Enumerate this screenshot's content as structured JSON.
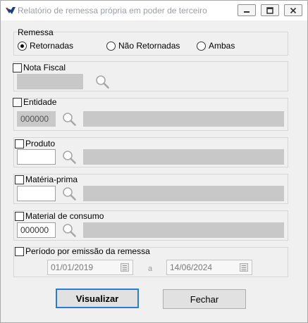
{
  "window": {
    "title": "Relatório de remessa própria em poder de terceiro"
  },
  "remessa": {
    "label": "Remessa",
    "options": [
      "Retornadas",
      "Não Retornadas",
      "Ambas"
    ],
    "selected": "Retornadas"
  },
  "nota_fiscal": {
    "label": "Nota Fiscal",
    "checked": false,
    "value": ""
  },
  "entidade": {
    "label": "Entidade",
    "checked": false,
    "code": "000000",
    "description": ""
  },
  "produto": {
    "label": "Produto",
    "checked": false,
    "code": "",
    "description": ""
  },
  "materia_prima": {
    "label": "Matéria-prima",
    "checked": false,
    "code": "",
    "description": ""
  },
  "material_consumo": {
    "label": "Material de consumo",
    "checked": false,
    "code": "000000",
    "description": ""
  },
  "periodo": {
    "label": "Período por emissão da remessa",
    "checked": false,
    "start": "01/01/2019",
    "separator": "a",
    "end": "14/06/2024"
  },
  "buttons": {
    "visualizar": "Visualizar",
    "fechar": "Fechar"
  },
  "colors": {
    "accent": "#2b7bd6",
    "disabled_field": "#c8c8c8",
    "title_text": "#9aa0a6"
  }
}
